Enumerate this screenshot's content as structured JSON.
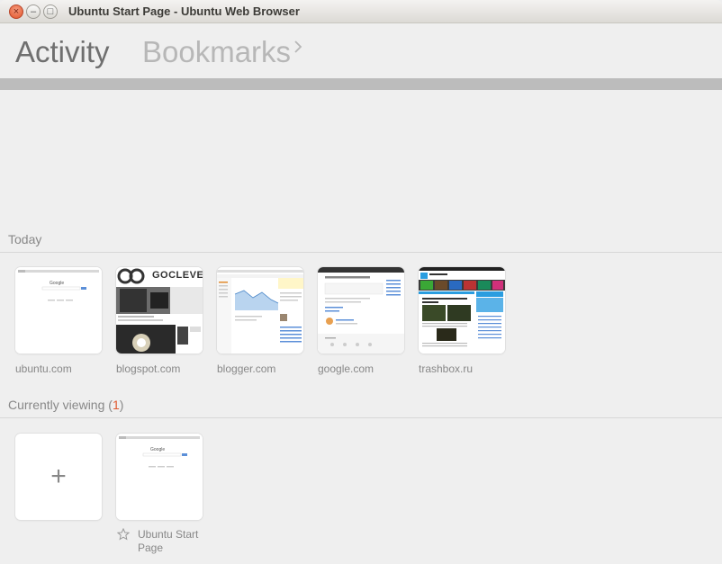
{
  "window": {
    "title": "Ubuntu Start Page - Ubuntu Web Browser",
    "close_glyph": "×",
    "min_glyph": "–",
    "max_glyph": "□"
  },
  "header": {
    "tab_activity": "Activity",
    "tab_bookmarks": "Bookmarks"
  },
  "today": {
    "title": "Today",
    "items": [
      {
        "label": "ubuntu.com"
      },
      {
        "label": "blogspot.com"
      },
      {
        "label": "blogger.com"
      },
      {
        "label": "google.com"
      },
      {
        "label": "trashbox.ru"
      }
    ],
    "blogspot_brand": "GOCLEVER"
  },
  "current": {
    "title_prefix": "Currently viewing (",
    "count": "1",
    "title_suffix": ")",
    "new_tab_glyph": "+",
    "tab_label_line1": "Ubuntu Start",
    "tab_label_line2": "Page"
  },
  "colors": {
    "accent": "#e0582d",
    "background": "#efefef",
    "bar": "#bcbcbc"
  }
}
